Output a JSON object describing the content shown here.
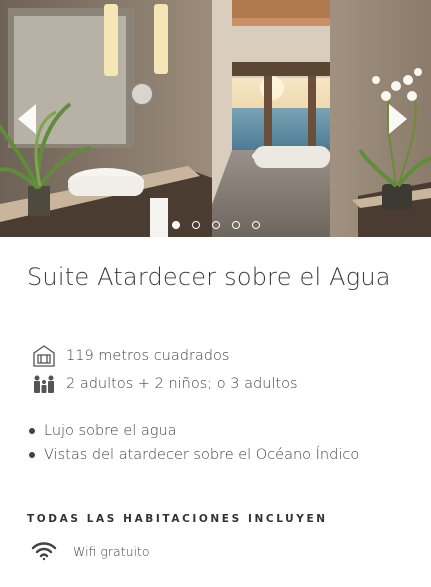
{
  "carousel": {
    "slide_count": 5,
    "active_index": 0,
    "icons": {
      "prev": "chevron-left-icon",
      "next": "chevron-right-icon"
    }
  },
  "room": {
    "title": "Suite Atardecer sobre el Agua",
    "facts": [
      {
        "icon": "house-area-icon",
        "text": "119 metros cuadrados"
      },
      {
        "icon": "guests-icon",
        "text": "2 adultos + 2 niños; o 3 adultos"
      }
    ],
    "features": [
      "Lujo sobre el agua",
      "Vistas del atardecer sobre el Océano Índico"
    ]
  },
  "includes": {
    "heading": "TODAS LAS HABITACIONES INCLUYEN",
    "items": [
      {
        "icon": "wifi-icon",
        "text": "Wifi gratuito"
      }
    ]
  },
  "colors": {
    "text": "#333333",
    "wall": "#8a7b6a",
    "sea": "#5e8fa8",
    "sunset": "#f2d7a6"
  }
}
